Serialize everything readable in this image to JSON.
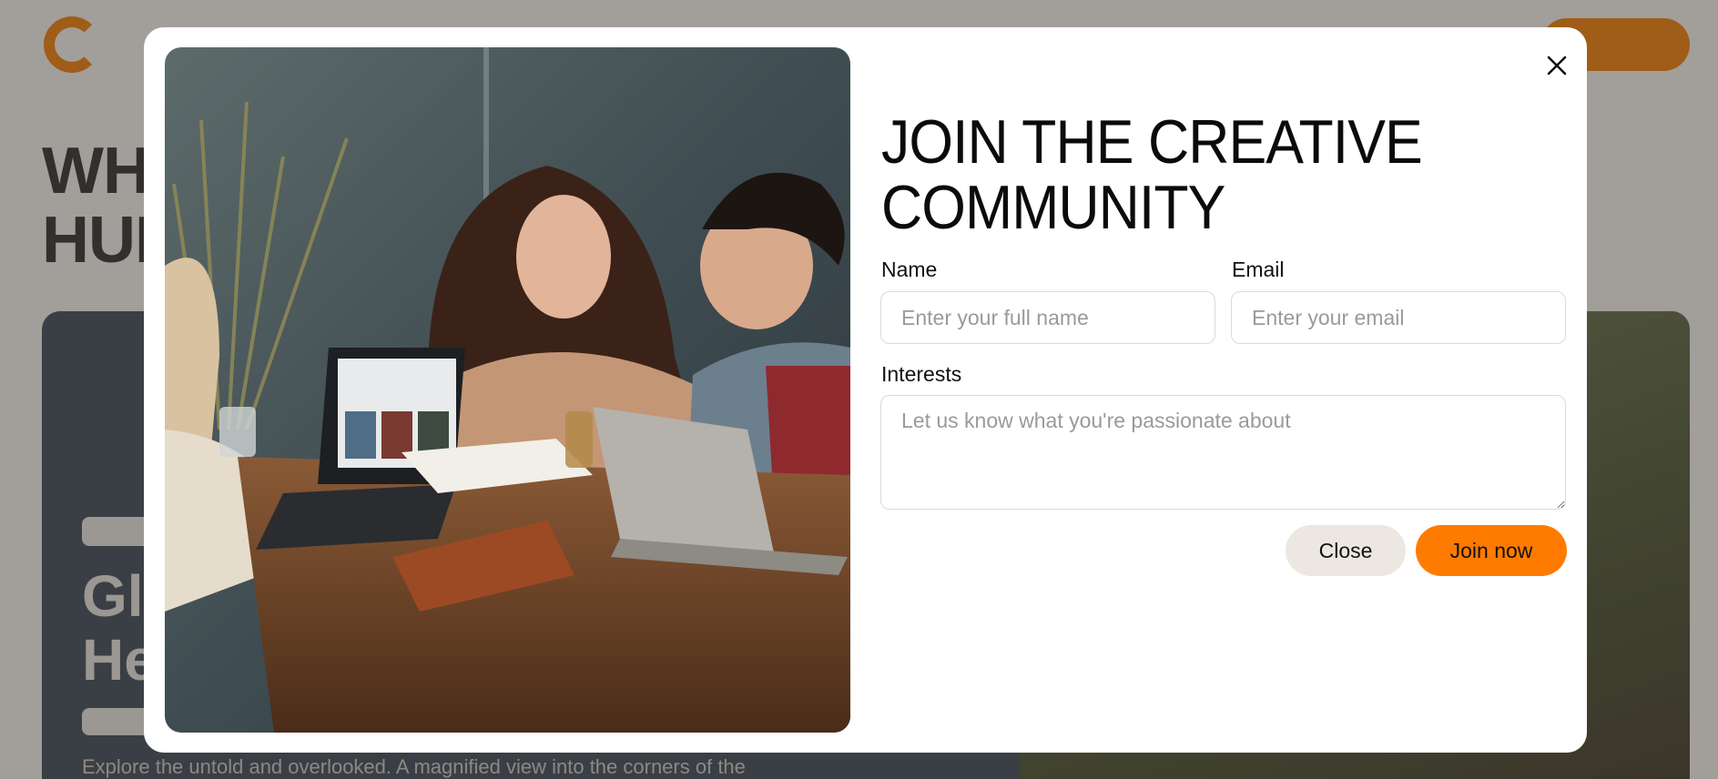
{
  "background": {
    "title_lines": [
      "WH",
      "HUB"
    ],
    "card_title_lines": [
      "Gl",
      "He"
    ],
    "card_desc": "Explore the untold and overlooked. A magnified view into the corners of the"
  },
  "modal": {
    "heading_line1": "JOIN THE CREATIVE",
    "heading_line2": "COMMUNITY",
    "name_label": "Name",
    "name_placeholder": "Enter your full name",
    "email_label": "Email",
    "email_placeholder": "Enter your email",
    "interests_label": "Interests",
    "interests_placeholder": "Let us know what you're passionate about",
    "close_label": "Close",
    "join_label": "Join now",
    "photo_alt": "Three people laughing around a table with laptops"
  },
  "colors": {
    "accent": "#ff7b00",
    "close_button": "#ece7e1"
  },
  "icons": {
    "close": "close-icon"
  }
}
